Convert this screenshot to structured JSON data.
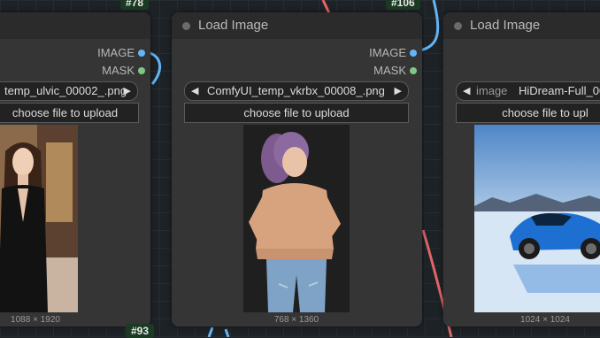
{
  "badges": {
    "top_left": "#78",
    "top_right": "#106",
    "bottom": "#93"
  },
  "node_left": {
    "output_image": "IMAGE",
    "output_mask": "MASK",
    "image_value": "temp_ulvic_00002_.png",
    "upload_label": "choose file to upload",
    "dims": "1088 × 1920"
  },
  "node_mid": {
    "title": "Load Image",
    "output_image": "IMAGE",
    "output_mask": "MASK",
    "image_value": "ComfyUI_temp_vkrbx_00008_.png",
    "upload_label": "choose file to upload",
    "dims": "768 × 1360"
  },
  "node_right": {
    "title": "Load Image",
    "image_label": "image",
    "image_value": "HiDream-Full_00",
    "upload_label": "choose file to upl",
    "dims": "1024 × 1024"
  },
  "colors": {
    "image_socket": "#64b5f6",
    "mask_socket": "#81c784",
    "link_blue": "#64b5f6",
    "link_red": "#e06666"
  },
  "icons": [
    "arrow-left-icon",
    "arrow-right-icon",
    "node-status-dot-icon"
  ]
}
